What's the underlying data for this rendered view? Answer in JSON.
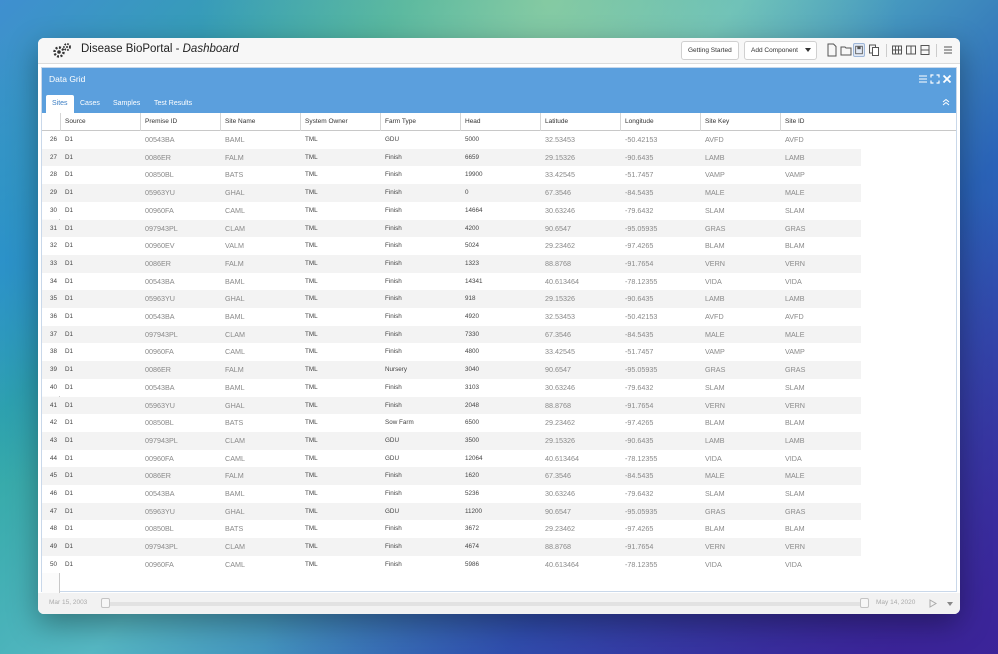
{
  "app": {
    "title_main": "Disease BioPortal - ",
    "title_sub": "Dashboard",
    "getting_started": "Getting Started",
    "add_component": "Add Component"
  },
  "panel": {
    "title": "Data Grid"
  },
  "tabs": [
    {
      "label": "Sites",
      "active": true
    },
    {
      "label": "Cases",
      "active": false
    },
    {
      "label": "Samples",
      "active": false
    },
    {
      "label": "Test Results",
      "active": false
    }
  ],
  "grid": {
    "columns": [
      "Source",
      "Premise ID",
      "Site Name",
      "System Owner",
      "Farm Type",
      "Head",
      "Latitude",
      "Longitude",
      "Site Key",
      "Site ID"
    ],
    "rows": [
      {
        "n": "26",
        "cells": [
          "D1",
          "00543BA",
          "BAML",
          "TML",
          "GDU",
          "5000",
          "32.53453",
          "-50.42153",
          "AVFD",
          "AVFD"
        ]
      },
      {
        "n": "27",
        "cells": [
          "D1",
          "0086ER",
          "FALM",
          "TML",
          "Finish",
          "6659",
          "29.15326",
          "-90.6435",
          "LAMB",
          "LAMB"
        ]
      },
      {
        "n": "28",
        "cells": [
          "D1",
          "00850BL",
          "BATS",
          "TML",
          "Finish",
          "19900",
          "33.42545",
          "-51.7457",
          "VAMP",
          "VAMP"
        ]
      },
      {
        "n": "29",
        "cells": [
          "D1",
          "05963YU",
          "GHAL",
          "TML",
          "Finish",
          "0",
          "67.3546",
          "-84.5435",
          "MALE",
          "MALE"
        ]
      },
      {
        "n": "30",
        "cells": [
          "D1",
          "00960FA",
          "CAML",
          "TML",
          "Finish",
          "14664",
          "30.63246",
          "-79.6432",
          "SLAM",
          "SLAM"
        ]
      },
      {
        "n": "31",
        "cells": [
          "D1",
          "097943PL",
          "CLAM",
          "TML",
          "Finish",
          "4200",
          "90.6547",
          "-95.05935",
          "GRAS",
          "GRAS"
        ]
      },
      {
        "n": "32",
        "cells": [
          "D1",
          "00960EV",
          "VALM",
          "TML",
          "Finish",
          "5024",
          "29.23462",
          "-97.4265",
          "BLAM",
          "BLAM"
        ]
      },
      {
        "n": "33",
        "cells": [
          "D1",
          "0086ER",
          "FALM",
          "TML",
          "Finish",
          "1323",
          "88.8768",
          "-91.7654",
          "VERN",
          "VERN"
        ]
      },
      {
        "n": "34",
        "cells": [
          "D1",
          "00543BA",
          "BAML",
          "TML",
          "Finish",
          "14341",
          "40.613464",
          "-78.12355",
          "VIDA",
          "VIDA"
        ]
      },
      {
        "n": "35",
        "cells": [
          "D1",
          "05963YU",
          "GHAL",
          "TML",
          "Finish",
          "918",
          "29.15326",
          "-90.6435",
          "LAMB",
          "LAMB"
        ]
      },
      {
        "n": "36",
        "cells": [
          "D1",
          "00543BA",
          "BAML",
          "TML",
          "Finish",
          "4920",
          "32.53453",
          "-50.42153",
          "AVFD",
          "AVFD"
        ]
      },
      {
        "n": "37",
        "cells": [
          "D1",
          "097943PL",
          "CLAM",
          "TML",
          "Finish",
          "7330",
          "67.3546",
          "-84.5435",
          "MALE",
          "MALE"
        ]
      },
      {
        "n": "38",
        "cells": [
          "D1",
          "00960FA",
          "CAML",
          "TML",
          "Finish",
          "4800",
          "33.42545",
          "-51.7457",
          "VAMP",
          "VAMP"
        ]
      },
      {
        "n": "39",
        "cells": [
          "D1",
          "0086ER",
          "FALM",
          "TML",
          "Nursery",
          "3040",
          "90.6547",
          "-95.05935",
          "GRAS",
          "GRAS"
        ]
      },
      {
        "n": "40",
        "cells": [
          "D1",
          "00543BA",
          "BAML",
          "TML",
          "Finish",
          "3103",
          "30.63246",
          "-79.6432",
          "SLAM",
          "SLAM"
        ]
      },
      {
        "n": "41",
        "cells": [
          "D1",
          "05963YU",
          "GHAL",
          "TML",
          "Finish",
          "2048",
          "88.8768",
          "-91.7654",
          "VERN",
          "VERN"
        ]
      },
      {
        "n": "42",
        "cells": [
          "D1",
          "00850BL",
          "BATS",
          "TML",
          "Sow Farm",
          "6500",
          "29.23462",
          "-97.4265",
          "BLAM",
          "BLAM"
        ]
      },
      {
        "n": "43",
        "cells": [
          "D1",
          "097943PL",
          "CLAM",
          "TML",
          "GDU",
          "3500",
          "29.15326",
          "-90.6435",
          "LAMB",
          "LAMB"
        ]
      },
      {
        "n": "44",
        "cells": [
          "D1",
          "00960FA",
          "CAML",
          "TML",
          "GDU",
          "12064",
          "40.613464",
          "-78.12355",
          "VIDA",
          "VIDA"
        ]
      },
      {
        "n": "45",
        "cells": [
          "D1",
          "0086ER",
          "FALM",
          "TML",
          "Finish",
          "1620",
          "67.3546",
          "-84.5435",
          "MALE",
          "MALE"
        ]
      },
      {
        "n": "46",
        "cells": [
          "D1",
          "00543BA",
          "BAML",
          "TML",
          "Finish",
          "5236",
          "30.63246",
          "-79.6432",
          "SLAM",
          "SLAM"
        ]
      },
      {
        "n": "47",
        "cells": [
          "D1",
          "05963YU",
          "GHAL",
          "TML",
          "GDU",
          "11200",
          "90.6547",
          "-95.05935",
          "GRAS",
          "GRAS"
        ]
      },
      {
        "n": "48",
        "cells": [
          "D1",
          "00850BL",
          "BATS",
          "TML",
          "Finish",
          "3672",
          "29.23462",
          "-97.4265",
          "BLAM",
          "BLAM"
        ]
      },
      {
        "n": "49",
        "cells": [
          "D1",
          "097943PL",
          "CLAM",
          "TML",
          "Finish",
          "4674",
          "88.8768",
          "-91.7654",
          "VERN",
          "VERN"
        ]
      },
      {
        "n": "50",
        "cells": [
          "D1",
          "00960FA",
          "CAML",
          "TML",
          "Finish",
          "5986",
          "40.613464",
          "-78.12355",
          "VIDA",
          "VIDA"
        ]
      }
    ]
  },
  "timeline": {
    "start_date": "Mar 15, 2003",
    "end_date": "May 14, 2020"
  },
  "colors": {
    "header_blue": "#5b9fdd",
    "tab_active_text": "#3d7fc4",
    "row_stripe": "#f3f3f3"
  },
  "icons": [
    "gear-icon",
    "new-doc-icon",
    "open-folder-icon",
    "save-icon",
    "copy-icon",
    "grid-layout-icon",
    "columns-layout-icon",
    "rows-layout-icon",
    "menu-icon",
    "expand-icon",
    "close-icon",
    "collapse-up-icon",
    "play-icon",
    "chevron-down-icon"
  ]
}
